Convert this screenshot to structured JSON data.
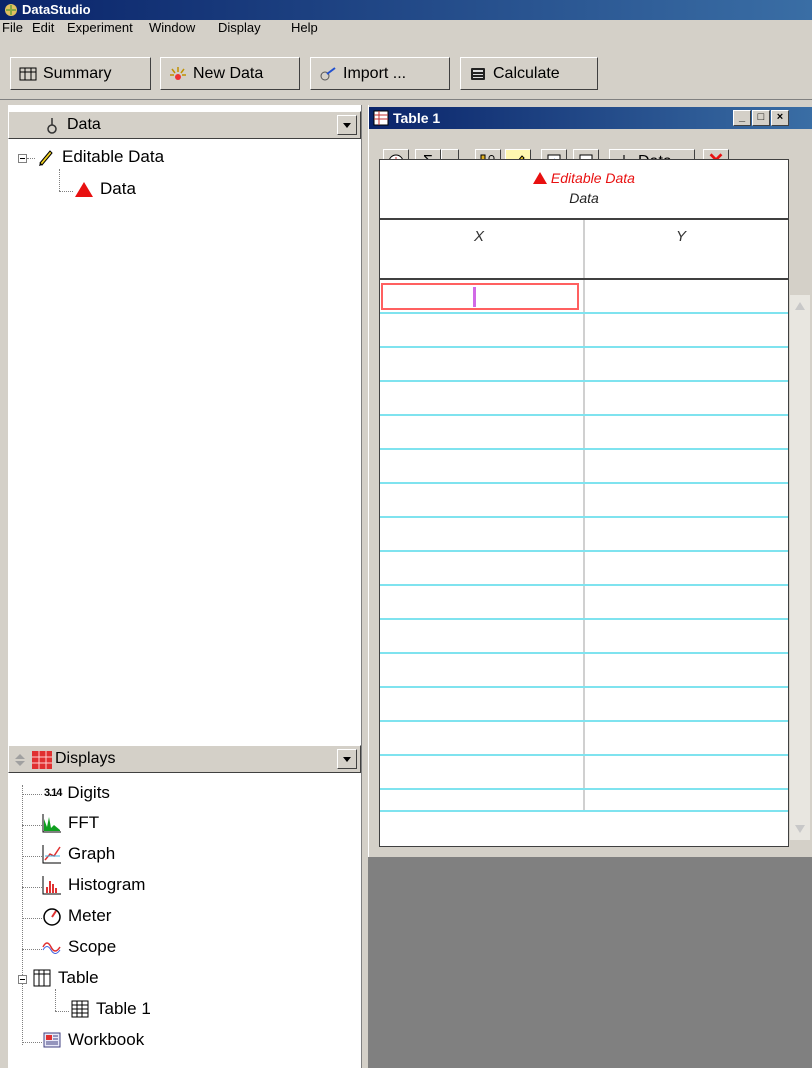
{
  "app": {
    "title": "DataStudio"
  },
  "menu": [
    "File",
    "Edit",
    "Experiment",
    "Window",
    "Display",
    "Help"
  ],
  "toolbar": {
    "summary": "Summary",
    "new_data": "New Data",
    "import": "Import ...",
    "calculate": "Calculate"
  },
  "data_panel": {
    "header": "Data",
    "tree": [
      {
        "label": "Editable Data"
      },
      {
        "label": "Data"
      }
    ]
  },
  "displays_panel": {
    "header": "Displays",
    "items": [
      {
        "label": "Digits",
        "icon_text": "3.14"
      },
      {
        "label": "FFT"
      },
      {
        "label": "Graph"
      },
      {
        "label": "Histogram"
      },
      {
        "label": "Meter"
      },
      {
        "label": "Scope"
      },
      {
        "label": "Table"
      },
      {
        "label": "Table 1"
      },
      {
        "label": "Workbook"
      }
    ]
  },
  "table_window": {
    "title": "Table 1",
    "data_dropdown": "Data",
    "source_name": "Editable Data",
    "source_subtitle": "Data",
    "columns": [
      "X",
      "Y"
    ],
    "colors": {
      "accent": "#e81010",
      "row_line": "#7fe3ef"
    }
  }
}
